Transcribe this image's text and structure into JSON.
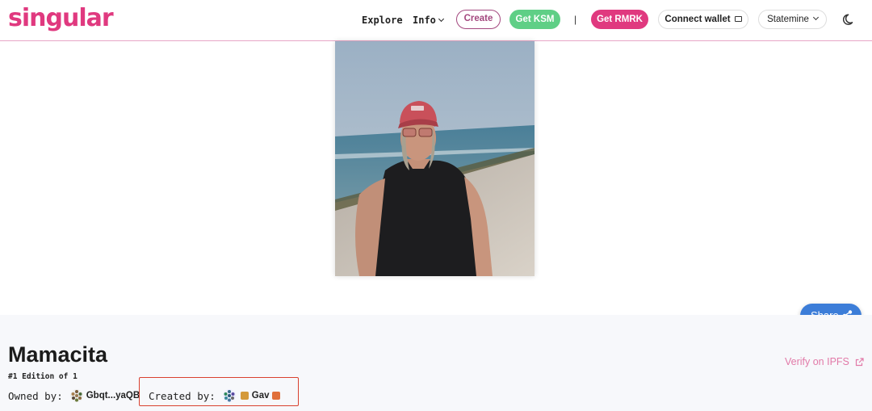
{
  "header": {
    "logo": "singular",
    "nav": {
      "explore": "Explore",
      "info": "Info"
    },
    "buttons": {
      "create": "Create",
      "get_ksm": "Get KSM",
      "separator": "|",
      "get_rmrk": "Get RMRK",
      "connect_wallet": "Connect wallet",
      "network": "Statemine"
    },
    "icons": {
      "wallet": "wallet-icon",
      "theme": "moon-icon"
    }
  },
  "media": {
    "alt": "photo of man in red cap on beach"
  },
  "share": {
    "label": "Share",
    "icon": "share-icon"
  },
  "nft": {
    "title": "Mamacita",
    "edition": "#1 Edition of 1",
    "owned_label": "Owned by:",
    "owner": "Gbqt...yaQB",
    "created_label": "Created by:",
    "creator": "Gav",
    "verify_label": "Verify on IPFS"
  },
  "colors": {
    "brand": "#e0397f",
    "ksm": "#5fcf86",
    "share": "#3c7dd8",
    "highlight_box": "#d9412f"
  }
}
